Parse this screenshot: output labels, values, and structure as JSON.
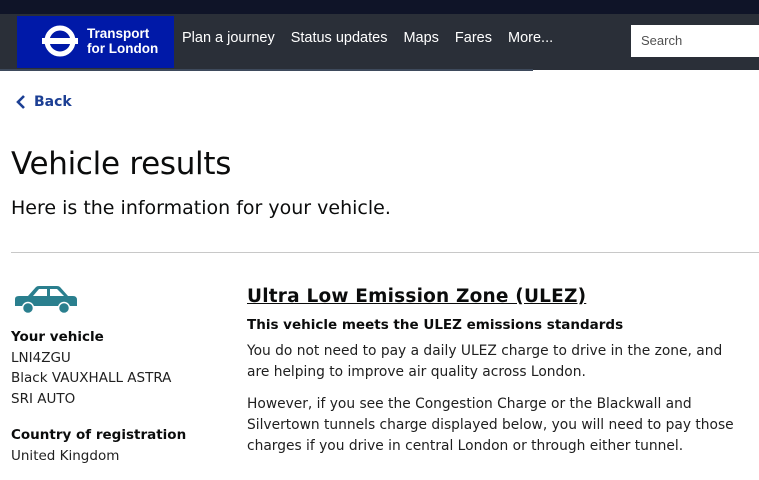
{
  "header": {
    "logo_line1": "Transport",
    "logo_line2": "for London",
    "nav": [
      "Plan a journey",
      "Status updates",
      "Maps",
      "Fares",
      "More..."
    ],
    "search_placeholder": "Search",
    "brand_color": "#0019a8"
  },
  "back_label": "Back",
  "page_title": "Vehicle results",
  "page_subtitle": "Here is the information for your vehicle.",
  "vehicle": {
    "icon": "car-icon",
    "your_vehicle_label": "Your vehicle",
    "registration": "LNI4ZGU",
    "make_model": "Black VAUXHALL ASTRA",
    "variant": "SRI AUTO",
    "country_label": "Country of registration",
    "country": "United Kingdom"
  },
  "ulez": {
    "heading": "Ultra Low Emission Zone (ULEZ)",
    "status": "This vehicle meets the ULEZ emissions standards",
    "para1": "You do not need to pay a daily ULEZ charge to drive in the zone, and are helping to improve air quality across London.",
    "para2": "However, if you see the Congestion Charge or the Blackwall and Silvertown tunnels charge displayed below, you will need to pay those charges if you drive in central London or through either tunnel."
  }
}
